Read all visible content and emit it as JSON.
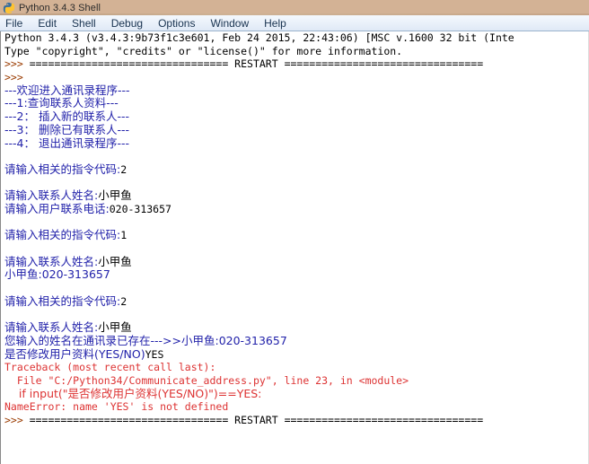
{
  "window": {
    "title": "Python 3.4.3 Shell",
    "icon": "python-logo-icon"
  },
  "menubar": {
    "items": [
      {
        "label": "File"
      },
      {
        "label": "Edit"
      },
      {
        "label": "Shell"
      },
      {
        "label": "Debug"
      },
      {
        "label": "Options"
      },
      {
        "label": "Window"
      },
      {
        "label": "Help"
      }
    ]
  },
  "console": {
    "lines": [
      {
        "id": "banner-version",
        "color": "black",
        "text": "Python 3.4.3 (v3.4.3:9b73f1c3e601, Feb 24 2015, 22:43:06) [MSC v.1600 32 bit (Inte"
      },
      {
        "id": "banner-help",
        "color": "black",
        "text": "Type \"copyright\", \"credits\" or \"license()\" for more information."
      },
      {
        "id": "restart-1",
        "color": "mixed-prompt-restart",
        "prompt": ">>> ",
        "text": "================================ RESTART ================================"
      },
      {
        "id": "prompt-1",
        "color": "brown",
        "text": ">>> "
      },
      {
        "id": "menu-welcome",
        "color": "blue",
        "text": "---欢迎进入通讯录程序---"
      },
      {
        "id": "menu-opt-1",
        "color": "blue",
        "text": "---1:查询联系人资料---"
      },
      {
        "id": "menu-opt-2",
        "color": "blue",
        "text": "---2： 插入新的联系人---"
      },
      {
        "id": "menu-opt-3",
        "color": "blue",
        "text": "---3： 删除已有联系人---"
      },
      {
        "id": "menu-opt-4",
        "color": "blue",
        "text": "---4： 退出通讯录程序---"
      },
      {
        "id": "blank-1",
        "color": "none",
        "text": ""
      },
      {
        "id": "ask-code-1",
        "color": "blue",
        "text": "请输入相关的指令代码:",
        "input": "2"
      },
      {
        "id": "blank-2",
        "color": "none",
        "text": ""
      },
      {
        "id": "ask-name-1",
        "color": "blue",
        "text": "请输入联系人姓名:",
        "input": "小甲鱼"
      },
      {
        "id": "ask-phone-1",
        "color": "blue",
        "text": "请输入用户联系电话:",
        "input": "020-313657"
      },
      {
        "id": "blank-3",
        "color": "none",
        "text": ""
      },
      {
        "id": "ask-code-2",
        "color": "blue",
        "text": "请输入相关的指令代码:",
        "input": "1"
      },
      {
        "id": "blank-4",
        "color": "none",
        "text": ""
      },
      {
        "id": "ask-name-2",
        "color": "blue",
        "text": "请输入联系人姓名:",
        "input": "小甲鱼"
      },
      {
        "id": "result-1",
        "color": "blue",
        "text": "小甲鱼:020-313657"
      },
      {
        "id": "blank-5",
        "color": "none",
        "text": ""
      },
      {
        "id": "ask-code-3",
        "color": "blue",
        "text": "请输入相关的指令代码:",
        "input": "2"
      },
      {
        "id": "blank-6",
        "color": "none",
        "text": ""
      },
      {
        "id": "ask-name-3",
        "color": "blue",
        "text": "请输入联系人姓名:",
        "input": "小甲鱼"
      },
      {
        "id": "exists-msg",
        "color": "blue",
        "text": "您输入的姓名在通讯录已存在--->>小甲鱼:020-313657"
      },
      {
        "id": "ask-modify",
        "color": "blue",
        "text": "是否修改用户资料(YES/NO)",
        "input": "YES"
      },
      {
        "id": "tb-header",
        "color": "red",
        "text": "Traceback (most recent call last):"
      },
      {
        "id": "tb-file",
        "color": "red",
        "text": "  File \"C:/Python34/Communicate_address.py\", line 23, in <module>"
      },
      {
        "id": "tb-code",
        "color": "red",
        "text": "    if input(\"是否修改用户资料(YES/NO)\")==YES:"
      },
      {
        "id": "tb-error",
        "color": "red",
        "text": "NameError: name 'YES' is not defined"
      },
      {
        "id": "restart-2",
        "color": "mixed-prompt-restart",
        "prompt": ">>> ",
        "text": "================================ RESTART ================================"
      }
    ],
    "restart_label": "RESTART",
    "prompt": ">>> "
  },
  "colors": {
    "output_blue": "#2222aa",
    "error_red": "#dd3333",
    "prompt_brown": "#9a3b00",
    "stdin_black": "#000000",
    "background": "#ffffff",
    "titlebar": "#d3b295",
    "menubar": "#eaf1fa"
  }
}
